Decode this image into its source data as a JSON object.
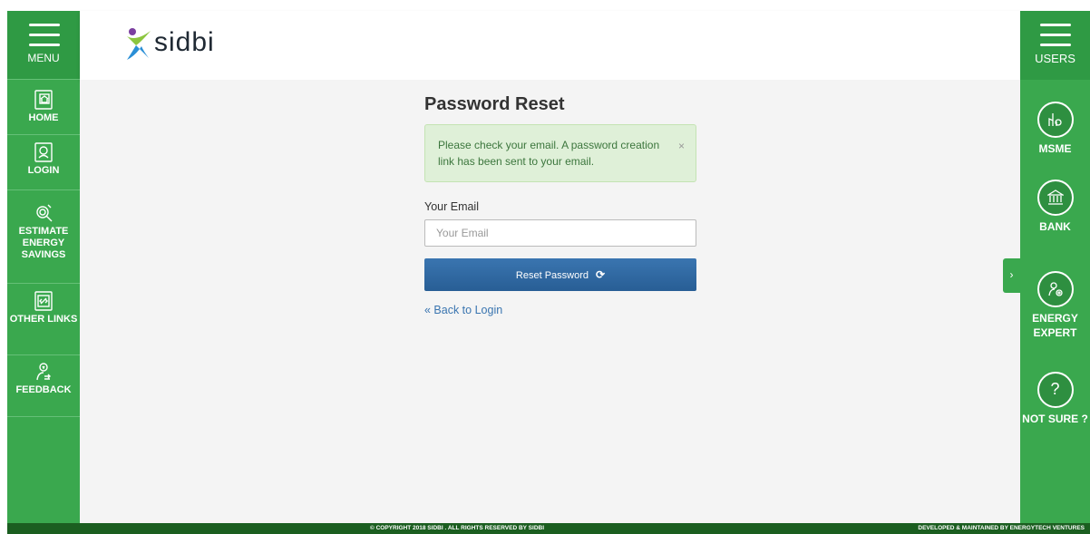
{
  "left_sidebar": {
    "menu_label": "MENU",
    "items": [
      {
        "label": "HOME",
        "icon": "home-icon"
      },
      {
        "label": "LOGIN",
        "icon": "login-icon"
      },
      {
        "label": "ESTIMATE ENERGY SAVINGS",
        "icon": "magnifier-icon"
      },
      {
        "label": "OTHER LINKS",
        "icon": "link-icon"
      },
      {
        "label": "FEEDBACK",
        "icon": "feedback-icon"
      }
    ]
  },
  "header": {
    "logo_text": "sidbi"
  },
  "form": {
    "title": "Password Reset",
    "alert_text": "Please check your email. A password creation link has been sent to your email.",
    "alert_close": "×",
    "email_label": "Your Email",
    "email_placeholder": "Your Email",
    "email_value": "",
    "reset_button": "Reset Password",
    "back_link": "« Back to Login"
  },
  "right_sidebar": {
    "users_label": "USERS",
    "tab_arrow": "›",
    "roles": [
      {
        "label": "MSME",
        "icon": "factory-icon"
      },
      {
        "label": "BANK",
        "icon": "bank-icon"
      },
      {
        "label": "ENERGY EXPERT",
        "icon": "expert-icon"
      },
      {
        "label": "NOT SURE ?",
        "icon": "question-icon",
        "glyph": "?"
      }
    ]
  },
  "footer": {
    "copyright": "© COPYRIGHT 2018 SIDBI . ALL RIGHTS RESERVED BY SIDBI",
    "developer": "DEVELOPED & MAINTAINED BY ENERGYTECH VENTURES"
  },
  "colors": {
    "sidebar_green": "#3aa84e",
    "alert_bg": "#dff0d8",
    "button_blue": "#2f6aa3",
    "footer_green": "#1b5e20"
  }
}
